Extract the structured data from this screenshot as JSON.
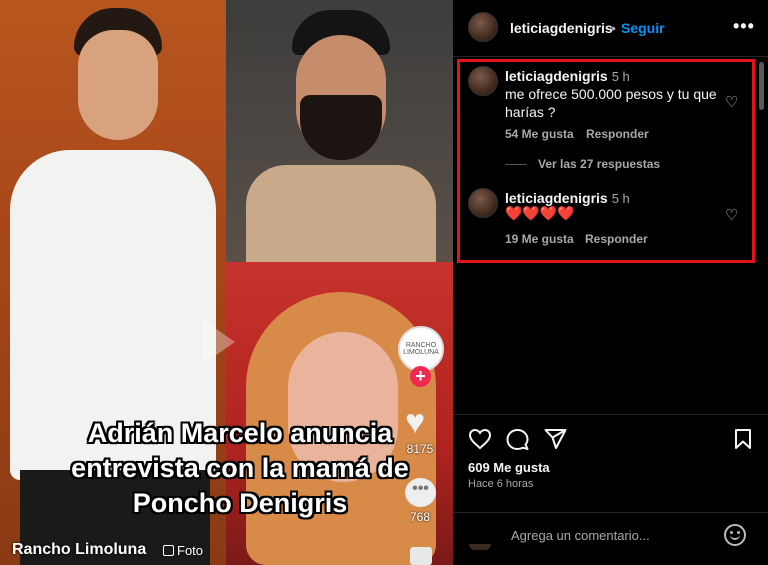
{
  "left_image": {
    "caption_lines": [
      "Adrián Marcelo anuncia",
      "entrevista con la mamá de",
      "Poncho Denigris"
    ],
    "source_name": "Rancho Limoluna",
    "source_type": "Foto",
    "tiktok": {
      "avatar_text": "RANCHO LIMOLUNA",
      "likes": "8175",
      "comments": "768"
    }
  },
  "post": {
    "header": {
      "username": "leticiagdenigris",
      "separator": "•",
      "follow_label": "Seguir",
      "more_label": "•••"
    },
    "comments": [
      {
        "username": "leticiagdenigris",
        "time": "5 h",
        "text_lines": [
          "me ofrece 500.000 pesos y tu que",
          "harías ?"
        ],
        "likes": "54 Me gusta",
        "reply_label": "Responder",
        "view_replies": "Ver las 27 respuestas"
      },
      {
        "username": "leticiagdenigris",
        "time": "5 h",
        "text": "❤️❤️❤️❤️",
        "likes": "19 Me gusta",
        "reply_label": "Responder"
      }
    ],
    "likes_total": "609 Me gusta",
    "time_ago": "Hace 6 horas",
    "add_comment_placeholder": "Agrega un comentario...",
    "icons": [
      "heart-icon",
      "comment-icon",
      "share-icon",
      "bookmark-icon",
      "emoji-icon",
      "more-icon"
    ],
    "colors": {
      "follow": "#0095f6",
      "highlight_box": "#e1141c",
      "background": "#000000"
    }
  }
}
